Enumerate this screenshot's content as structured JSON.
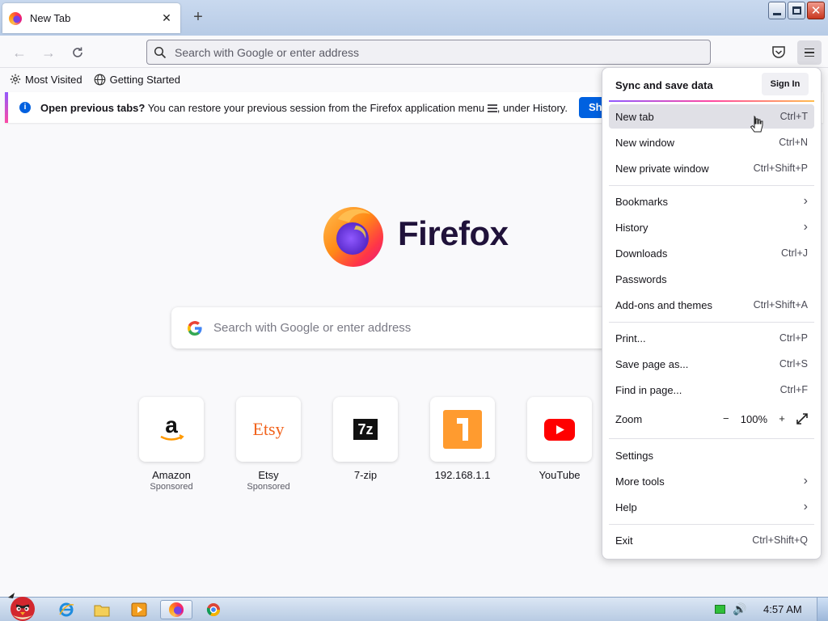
{
  "browser": {
    "tab": {
      "title": "New Tab"
    },
    "urlbar_placeholder": "Search with Google or enter address"
  },
  "bookmarks": [
    {
      "label": "Most Visited",
      "icon": "gear-icon"
    },
    {
      "label": "Getting Started",
      "icon": "globe-icon"
    }
  ],
  "notification": {
    "bold": "Open previous tabs?",
    "text": " You can restore your previous session from the Firefox application menu ",
    "tail": ", under History.",
    "button": "Sho"
  },
  "newtab": {
    "brand": "Firefox",
    "search_placeholder": "Search with Google or enter address",
    "tiles": [
      {
        "name": "Amazon",
        "sponsored": "Sponsored"
      },
      {
        "name": "Etsy",
        "sponsored": "Sponsored",
        "logo_text": "Etsy"
      },
      {
        "name": "7-zip",
        "logo_text": "7z"
      },
      {
        "name": "192.168.1.1"
      },
      {
        "name": "YouTube"
      }
    ]
  },
  "menu": {
    "sync_label": "Sync and save data",
    "sign_in": "Sign In",
    "items": [
      {
        "label": "New tab",
        "shortcut": "Ctrl+T"
      },
      {
        "label": "New window",
        "shortcut": "Ctrl+N"
      },
      {
        "label": "New private window",
        "shortcut": "Ctrl+Shift+P"
      },
      {
        "label": "Bookmarks"
      },
      {
        "label": "History"
      },
      {
        "label": "Downloads",
        "shortcut": "Ctrl+J"
      },
      {
        "label": "Passwords"
      },
      {
        "label": "Add-ons and themes",
        "shortcut": "Ctrl+Shift+A"
      },
      {
        "label": "Print...",
        "shortcut": "Ctrl+P"
      },
      {
        "label": "Save page as...",
        "shortcut": "Ctrl+S"
      },
      {
        "label": "Find in page...",
        "shortcut": "Ctrl+F"
      },
      {
        "label": "Zoom",
        "value": "100%"
      },
      {
        "label": "Settings"
      },
      {
        "label": "More tools"
      },
      {
        "label": "Help"
      },
      {
        "label": "Exit",
        "shortcut": "Ctrl+Shift+Q"
      }
    ]
  },
  "taskbar": {
    "time": "4:57 AM"
  },
  "colors": {
    "accent": "#0061e0",
    "brand_dark": "#20123a",
    "menu_hover": "#e0e0e6"
  }
}
